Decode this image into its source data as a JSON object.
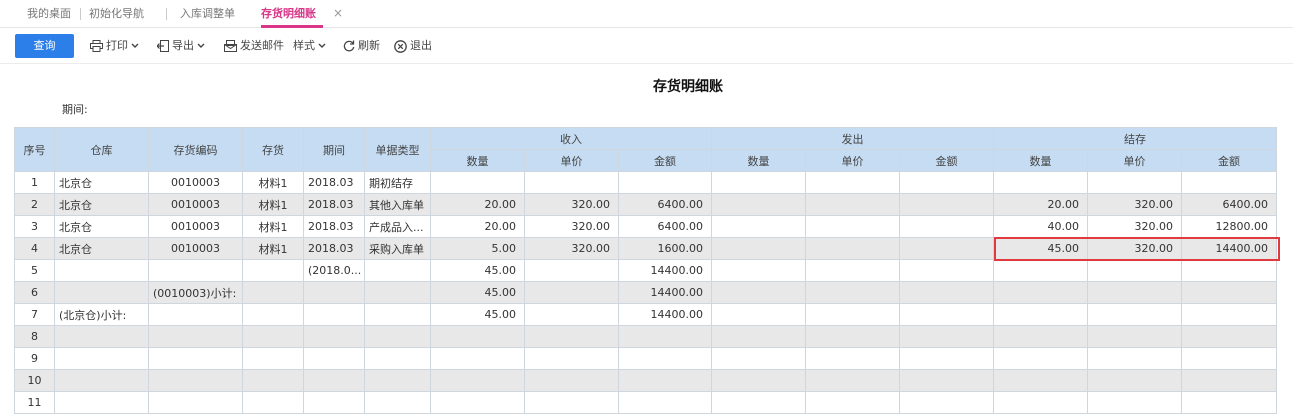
{
  "tabs": [
    {
      "label": "我的桌面"
    },
    {
      "label": "初始化导航"
    },
    {
      "label": "入库调整单"
    },
    {
      "label": "存货明细账"
    }
  ],
  "tab_close": "×",
  "toolbar": {
    "query": "查询",
    "print": "打印",
    "export": "导出",
    "send_email": "发送邮件",
    "style": "样式",
    "refresh": "刷新",
    "exit": "退出"
  },
  "report": {
    "title": "存货明细账",
    "period_label": "期间:"
  },
  "header": {
    "seq": "序号",
    "warehouse": "仓库",
    "code": "存货编码",
    "item": "存货",
    "period": "期间",
    "doc_type": "单据类型",
    "receipt": "收入",
    "issue": "发出",
    "balance": "结存",
    "qty": "数量",
    "price": "单价",
    "amount": "金额"
  },
  "rows": [
    {
      "seq": "1",
      "wh": "北京仓",
      "code": "0010003",
      "item": "材料1",
      "period": "2018.03",
      "type": "期初结存",
      "rq": "",
      "rp": "",
      "ra": "",
      "iq": "",
      "ip": "",
      "ia": "",
      "bq": "",
      "bp": "",
      "ba": ""
    },
    {
      "seq": "2",
      "wh": "北京仓",
      "code": "0010003",
      "item": "材料1",
      "period": "2018.03",
      "type": "其他入库单",
      "rq": "20.00",
      "rp": "320.00",
      "ra": "6400.00",
      "iq": "",
      "ip": "",
      "ia": "",
      "bq": "20.00",
      "bp": "320.00",
      "ba": "6400.00"
    },
    {
      "seq": "3",
      "wh": "北京仓",
      "code": "0010003",
      "item": "材料1",
      "period": "2018.03",
      "type": "产成品入...",
      "rq": "20.00",
      "rp": "320.00",
      "ra": "6400.00",
      "iq": "",
      "ip": "",
      "ia": "",
      "bq": "40.00",
      "bp": "320.00",
      "ba": "12800.00"
    },
    {
      "seq": "4",
      "wh": "北京仓",
      "code": "0010003",
      "item": "材料1",
      "period": "2018.03",
      "type": "采购入库单",
      "rq": "5.00",
      "rp": "320.00",
      "ra": "1600.00",
      "iq": "",
      "ip": "",
      "ia": "",
      "bq": "45.00",
      "bp": "320.00",
      "ba": "14400.00"
    },
    {
      "seq": "5",
      "wh": "",
      "code": "",
      "item": "",
      "period": "(2018.0...",
      "type": "",
      "rq": "45.00",
      "rp": "",
      "ra": "14400.00",
      "iq": "",
      "ip": "",
      "ia": "",
      "bq": "",
      "bp": "",
      "ba": ""
    },
    {
      "seq": "6",
      "wh": "",
      "code": "(0010003)小计:",
      "item": "",
      "period": "",
      "type": "",
      "rq": "45.00",
      "rp": "",
      "ra": "14400.00",
      "iq": "",
      "ip": "",
      "ia": "",
      "bq": "",
      "bp": "",
      "ba": ""
    },
    {
      "seq": "7",
      "wh": "(北京仓)小计:",
      "code": "",
      "item": "",
      "period": "",
      "type": "",
      "rq": "45.00",
      "rp": "",
      "ra": "14400.00",
      "iq": "",
      "ip": "",
      "ia": "",
      "bq": "",
      "bp": "",
      "ba": ""
    },
    {
      "seq": "8",
      "wh": "",
      "code": "",
      "item": "",
      "period": "",
      "type": "",
      "rq": "",
      "rp": "",
      "ra": "",
      "iq": "",
      "ip": "",
      "ia": "",
      "bq": "",
      "bp": "",
      "ba": ""
    },
    {
      "seq": "9",
      "wh": "",
      "code": "",
      "item": "",
      "period": "",
      "type": "",
      "rq": "",
      "rp": "",
      "ra": "",
      "iq": "",
      "ip": "",
      "ia": "",
      "bq": "",
      "bp": "",
      "ba": ""
    },
    {
      "seq": "10",
      "wh": "",
      "code": "",
      "item": "",
      "period": "",
      "type": "",
      "rq": "",
      "rp": "",
      "ra": "",
      "iq": "",
      "ip": "",
      "ia": "",
      "bq": "",
      "bp": "",
      "ba": ""
    },
    {
      "seq": "11",
      "wh": "",
      "code": "",
      "item": "",
      "period": "",
      "type": "",
      "rq": "",
      "rp": "",
      "ra": "",
      "iq": "",
      "ip": "",
      "ia": "",
      "bq": "",
      "bp": "",
      "ba": ""
    }
  ],
  "colors": {
    "active_tab": "#d9368a",
    "query_button": "#2c7ee8",
    "header_bg": "#c5dcf3",
    "highlight_border": "#e0393e",
    "link": "#2a3fb8"
  },
  "icons": [
    "print-icon",
    "export-icon",
    "email-icon",
    "refresh-icon",
    "exit-icon",
    "chevron-down-icon",
    "close-icon"
  ]
}
